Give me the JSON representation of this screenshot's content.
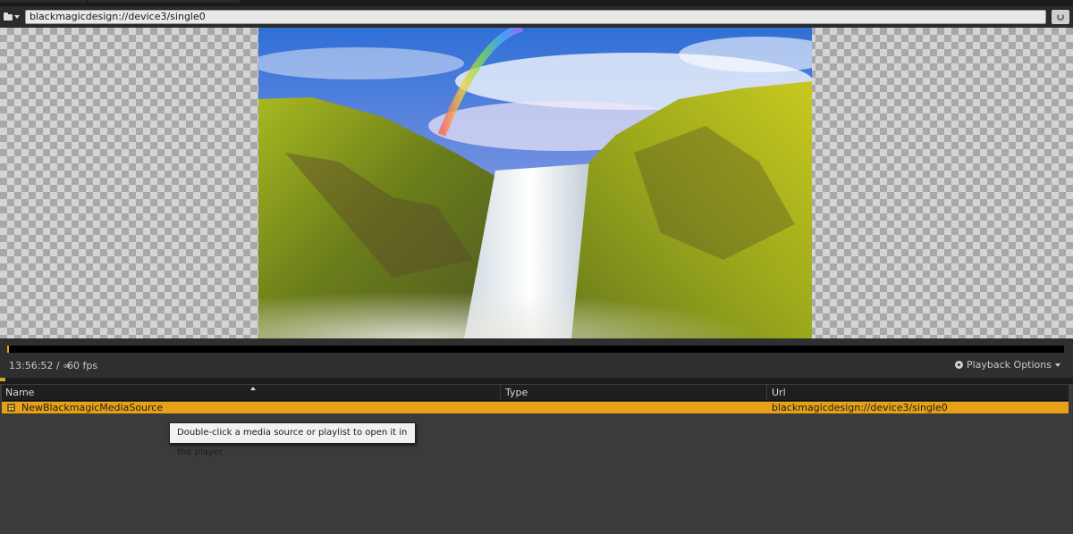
{
  "toolbar": {
    "url_value": "blackmagicdesign://device3/single0"
  },
  "viewport": {
    "media_subject": "waterfall with rainbow over mossy cliffs"
  },
  "playback": {
    "time": "13:56:52 / ∞",
    "fps": "60 fps",
    "options_label": "Playback Options",
    "progress": 0.0
  },
  "list": {
    "columns": [
      "Name",
      "Type",
      "Url"
    ],
    "rows": [
      {
        "name": "NewBlackmagicMediaSource",
        "type": "",
        "url": "blackmagicdesign://device3/single0",
        "selected": true
      }
    ]
  },
  "tooltip": {
    "text": "Double-click a media source or playlist to open it in the player."
  },
  "colors": {
    "accent": "#e6a117",
    "panel": "#3b3b3b",
    "header": "#1f1f1f"
  }
}
